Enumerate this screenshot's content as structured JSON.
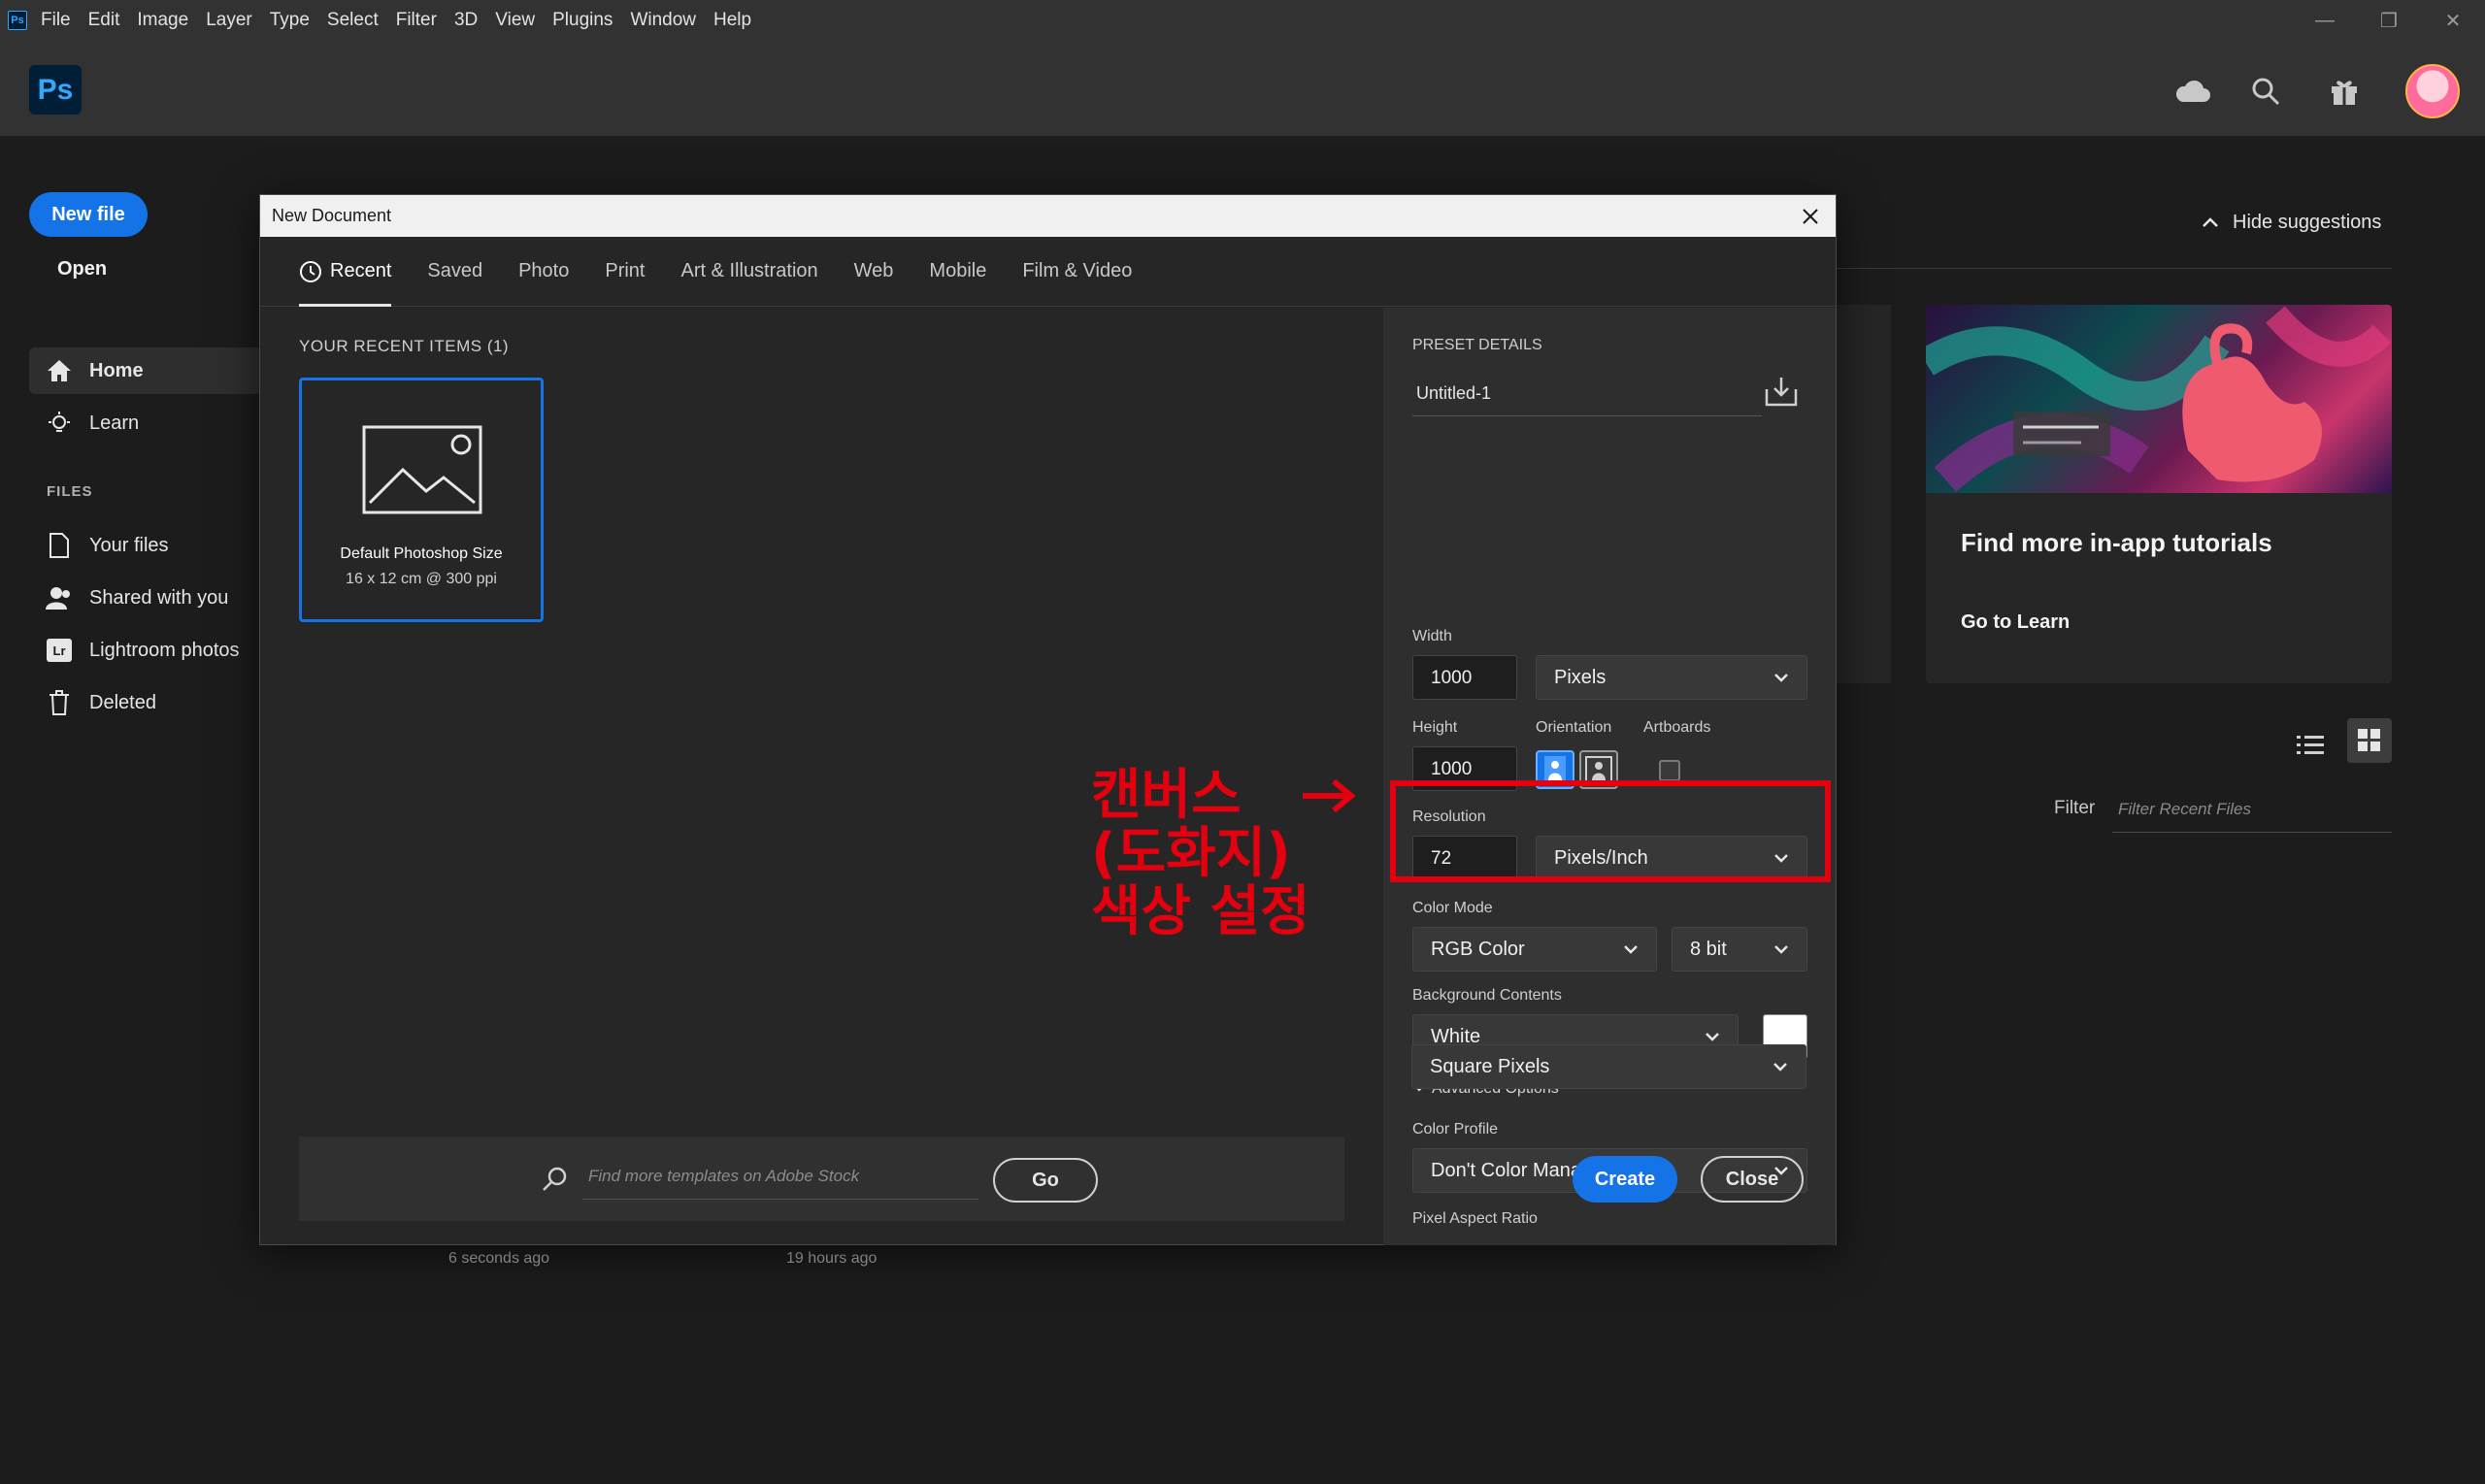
{
  "menubar": {
    "app_badge": "Ps",
    "items": [
      "File",
      "Edit",
      "Image",
      "Layer",
      "Type",
      "Select",
      "Filter",
      "3D",
      "View",
      "Plugins",
      "Window",
      "Help"
    ]
  },
  "window_controls": {
    "minimize": "—",
    "restore": "❐",
    "close": "✕"
  },
  "header": {
    "logo": "Ps"
  },
  "left_nav": {
    "new_file": "New file",
    "open": "Open",
    "home": "Home",
    "learn": "Learn",
    "files_label": "FILES",
    "your_files": "Your files",
    "shared": "Shared with you",
    "lightroom": "Lightroom photos",
    "lightroom_badge": "Lr",
    "deleted": "Deleted"
  },
  "suggestions": {
    "hide": "Hide suggestions",
    "tutorial_title": "Find more in-app tutorials",
    "tutorial_link": "Go to Learn"
  },
  "filter": {
    "label": "Filter",
    "placeholder": "Filter Recent Files"
  },
  "bg_times": [
    "6 seconds ago",
    "19 hours ago"
  ],
  "dialog": {
    "title": "New Document",
    "tabs": [
      "Recent",
      "Saved",
      "Photo",
      "Print",
      "Art & Illustration",
      "Web",
      "Mobile",
      "Film & Video"
    ],
    "recent_heading": "YOUR RECENT ITEMS  (1)",
    "preset_name": "Default Photoshop Size",
    "preset_size": "16 x 12 cm @ 300 ppi",
    "stock_placeholder": "Find more templates on Adobe Stock",
    "go": "Go"
  },
  "details": {
    "heading": "PRESET DETAILS",
    "doc_name": "Untitled-1",
    "width_label": "Width",
    "width": "1000",
    "width_unit": "Pixels",
    "height_label": "Height",
    "height": "1000",
    "orientation_label": "Orientation",
    "artboards_label": "Artboards",
    "resolution_label": "Resolution",
    "resolution": "72",
    "resolution_unit": "Pixels/Inch",
    "color_mode_label": "Color Mode",
    "color_mode": "RGB Color",
    "bit_depth": "8 bit",
    "bg_contents_label": "Background Contents",
    "bg_contents": "White",
    "advanced": "Advanced Options",
    "color_profile_label": "Color Profile",
    "color_profile": "Don't Color Manage",
    "pixel_aspect_label": "Pixel Aspect Ratio",
    "pixel_aspect": "Square Pixels",
    "create": "Create",
    "close": "Close"
  },
  "annotation": {
    "lines": [
      "캔버스",
      "(도화지)",
      "색상 설정"
    ],
    "arrow": "→"
  },
  "colors": {
    "accent": "#1473e6",
    "annotation": "#e3000f",
    "swatch": "#ffffff"
  }
}
